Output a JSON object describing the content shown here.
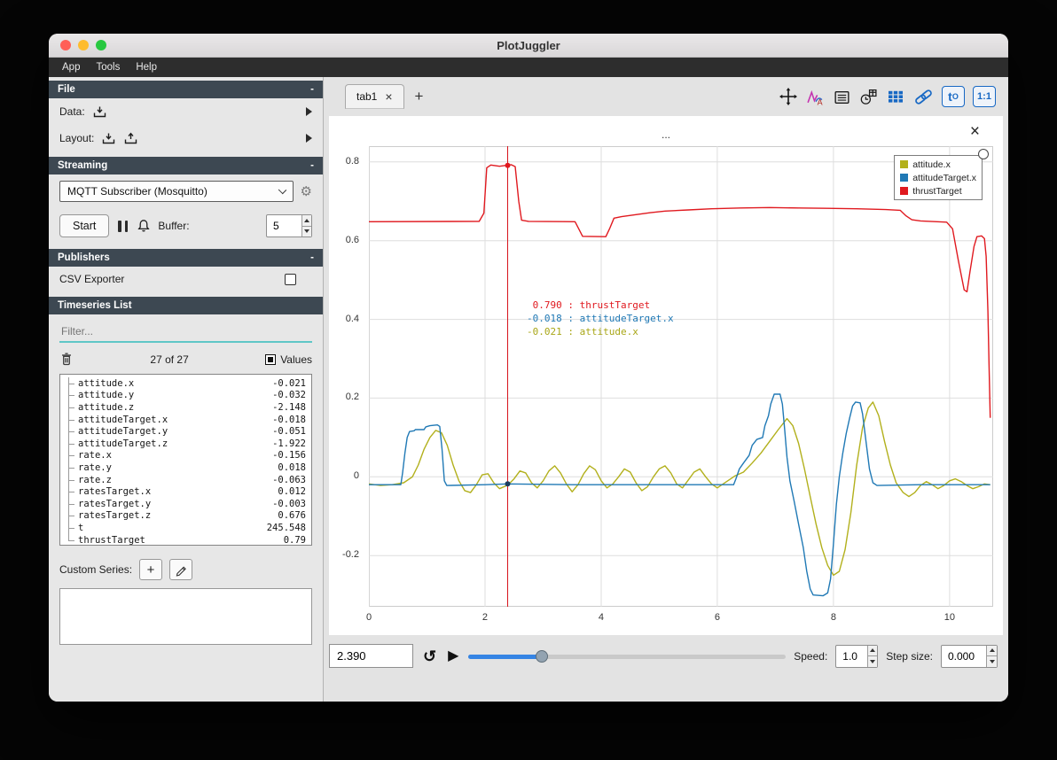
{
  "window": {
    "title": "PlotJuggler"
  },
  "menu": {
    "items": [
      "App",
      "Tools",
      "Help"
    ]
  },
  "sidebar": {
    "file": {
      "title": "File",
      "collapse": "-",
      "data_label": "Data:",
      "layout_label": "Layout:"
    },
    "streaming": {
      "title": "Streaming",
      "collapse": "-",
      "source": "MQTT Subscriber (Mosquitto)",
      "start_label": "Start",
      "buffer_label": "Buffer:",
      "buffer_value": "5"
    },
    "publishers": {
      "title": "Publishers",
      "collapse": "-",
      "csv_label": "CSV Exporter"
    },
    "timeseries": {
      "title": "Timeseries List",
      "collapse": "-",
      "filter_placeholder": "Filter...",
      "count": "27 of 27",
      "values_label": "Values",
      "items": [
        {
          "name": "attitude.x",
          "value": "-0.021"
        },
        {
          "name": "attitude.y",
          "value": "-0.032"
        },
        {
          "name": "attitude.z",
          "value": "-2.148"
        },
        {
          "name": "attitudeTarget.x",
          "value": "-0.018"
        },
        {
          "name": "attitudeTarget.y",
          "value": "-0.051"
        },
        {
          "name": "attitudeTarget.z",
          "value": "-1.922"
        },
        {
          "name": "rate.x",
          "value": "-0.156"
        },
        {
          "name": "rate.y",
          "value": "0.018"
        },
        {
          "name": "rate.z",
          "value": "-0.063"
        },
        {
          "name": "ratesTarget.x",
          "value": "0.012"
        },
        {
          "name": "ratesTarget.y",
          "value": "-0.003"
        },
        {
          "name": "ratesTarget.z",
          "value": "0.676"
        },
        {
          "name": "t",
          "value": "245.548"
        },
        {
          "name": "thrustTarget",
          "value": "0.79"
        }
      ]
    },
    "custom_series": {
      "label": "Custom Series:",
      "add_label": "+"
    }
  },
  "tabs": {
    "active": "tab1",
    "close": "×",
    "add": "+"
  },
  "toolbar": {
    "t_label": "t",
    "t_sub": "O",
    "ratio_label": "1:1"
  },
  "plot": {
    "title": "...",
    "close": "×",
    "legend": [
      {
        "label": "attitude.x",
        "color": "#b2b01c"
      },
      {
        "label": "attitudeTarget.x",
        "color": "#2079b5"
      },
      {
        "label": "thrustTarget",
        "color": "#e0191f"
      }
    ],
    "tracker_lines": [
      {
        "text": " 0.790 : thrustTarget",
        "color": "#e0191f"
      },
      {
        "text": "-0.018 : attitudeTarget.x",
        "color": "#2079b5"
      },
      {
        "text": "-0.021 : attitude.x",
        "color": "#a8a616"
      }
    ]
  },
  "chart_data": {
    "type": "line",
    "title": "...",
    "xlim": [
      0,
      10.75
    ],
    "ylim": [
      -0.33,
      0.84
    ],
    "x_ticks": [
      0,
      2,
      4,
      6,
      8,
      10
    ],
    "y_ticks": [
      -0.2,
      0,
      0.2,
      0.4,
      0.6,
      0.8
    ],
    "grid": true,
    "legend_position": "top-right",
    "tracker_x": 2.39,
    "tracker_color": "#d8141c",
    "tracker_markers": [
      {
        "x": 2.39,
        "y": 0.791,
        "color": "#e0191f"
      },
      {
        "x": 2.39,
        "y": -0.018,
        "color": "#1b3d5f"
      }
    ],
    "series": [
      {
        "name": "attitude.x",
        "color": "#b2b01c",
        "points": [
          [
            0,
            -0.018
          ],
          [
            0.2,
            -0.022
          ],
          [
            0.4,
            -0.02
          ],
          [
            0.6,
            -0.015
          ],
          [
            0.75,
            0
          ],
          [
            0.85,
            0.03
          ],
          [
            0.95,
            0.07
          ],
          [
            1.05,
            0.1
          ],
          [
            1.15,
            0.118
          ],
          [
            1.25,
            0.112
          ],
          [
            1.35,
            0.08
          ],
          [
            1.45,
            0.03
          ],
          [
            1.55,
            -0.01
          ],
          [
            1.65,
            -0.035
          ],
          [
            1.75,
            -0.04
          ],
          [
            1.85,
            -0.02
          ],
          [
            1.95,
            0.005
          ],
          [
            2.05,
            0.008
          ],
          [
            2.15,
            -0.015
          ],
          [
            2.25,
            -0.03
          ],
          [
            2.39,
            -0.021
          ],
          [
            2.5,
            -0.005
          ],
          [
            2.6,
            0.015
          ],
          [
            2.7,
            0.01
          ],
          [
            2.8,
            -0.015
          ],
          [
            2.9,
            -0.028
          ],
          [
            3,
            -0.01
          ],
          [
            3.1,
            0.015
          ],
          [
            3.2,
            0.028
          ],
          [
            3.3,
            0.01
          ],
          [
            3.4,
            -0.018
          ],
          [
            3.5,
            -0.038
          ],
          [
            3.6,
            -0.02
          ],
          [
            3.7,
            0.008
          ],
          [
            3.8,
            0.028
          ],
          [
            3.9,
            0.018
          ],
          [
            4,
            -0.01
          ],
          [
            4.1,
            -0.028
          ],
          [
            4.2,
            -0.018
          ],
          [
            4.3,
            0
          ],
          [
            4.4,
            0.02
          ],
          [
            4.5,
            0.012
          ],
          [
            4.6,
            -0.015
          ],
          [
            4.7,
            -0.035
          ],
          [
            4.8,
            -0.025
          ],
          [
            4.9,
            0
          ],
          [
            5,
            0.02
          ],
          [
            5.1,
            0.028
          ],
          [
            5.2,
            0.01
          ],
          [
            5.3,
            -0.018
          ],
          [
            5.4,
            -0.028
          ],
          [
            5.5,
            -0.008
          ],
          [
            5.6,
            0.012
          ],
          [
            5.7,
            0.02
          ],
          [
            5.8,
            0
          ],
          [
            5.9,
            -0.018
          ],
          [
            6,
            -0.028
          ],
          [
            6.1,
            -0.018
          ],
          [
            6.2,
            -0.008
          ],
          [
            6.3,
            0.002
          ],
          [
            6.45,
            0.012
          ],
          [
            6.6,
            0.035
          ],
          [
            6.75,
            0.06
          ],
          [
            6.9,
            0.09
          ],
          [
            7.05,
            0.12
          ],
          [
            7.2,
            0.148
          ],
          [
            7.3,
            0.13
          ],
          [
            7.4,
            0.085
          ],
          [
            7.5,
            0.02
          ],
          [
            7.6,
            -0.05
          ],
          [
            7.7,
            -0.12
          ],
          [
            7.8,
            -0.18
          ],
          [
            7.9,
            -0.225
          ],
          [
            8,
            -0.25
          ],
          [
            8.1,
            -0.24
          ],
          [
            8.2,
            -0.185
          ],
          [
            8.3,
            -0.09
          ],
          [
            8.4,
            0.03
          ],
          [
            8.5,
            0.125
          ],
          [
            8.6,
            0.175
          ],
          [
            8.68,
            0.19
          ],
          [
            8.78,
            0.155
          ],
          [
            8.88,
            0.09
          ],
          [
            8.98,
            0.03
          ],
          [
            9.08,
            -0.015
          ],
          [
            9.2,
            -0.04
          ],
          [
            9.3,
            -0.05
          ],
          [
            9.4,
            -0.04
          ],
          [
            9.5,
            -0.022
          ],
          [
            9.6,
            -0.012
          ],
          [
            9.7,
            -0.02
          ],
          [
            9.8,
            -0.03
          ],
          [
            9.9,
            -0.022
          ],
          [
            10,
            -0.01
          ],
          [
            10.1,
            -0.005
          ],
          [
            10.2,
            -0.012
          ],
          [
            10.3,
            -0.022
          ],
          [
            10.4,
            -0.03
          ],
          [
            10.5,
            -0.025
          ],
          [
            10.6,
            -0.018
          ],
          [
            10.7,
            -0.02
          ]
        ]
      },
      {
        "name": "attitudeTarget.x",
        "color": "#2079b5",
        "points": [
          [
            0,
            -0.02
          ],
          [
            0.55,
            -0.02
          ],
          [
            0.58,
            0.01
          ],
          [
            0.62,
            0.06
          ],
          [
            0.66,
            0.1
          ],
          [
            0.7,
            0.115
          ],
          [
            0.78,
            0.117
          ],
          [
            0.8,
            0.12
          ],
          [
            0.95,
            0.12
          ],
          [
            0.98,
            0.127
          ],
          [
            1.05,
            0.13
          ],
          [
            1.18,
            0.132
          ],
          [
            1.22,
            0.128
          ],
          [
            1.26,
            0.07
          ],
          [
            1.3,
            -0.01
          ],
          [
            1.34,
            -0.022
          ],
          [
            2,
            -0.02
          ],
          [
            2.39,
            -0.018
          ],
          [
            3.5,
            -0.02
          ],
          [
            5,
            -0.02
          ],
          [
            6.28,
            -0.02
          ],
          [
            6.32,
            -0.005
          ],
          [
            6.38,
            0.02
          ],
          [
            6.45,
            0.035
          ],
          [
            6.55,
            0.055
          ],
          [
            6.6,
            0.08
          ],
          [
            6.68,
            0.095
          ],
          [
            6.78,
            0.1
          ],
          [
            6.82,
            0.13
          ],
          [
            6.88,
            0.155
          ],
          [
            6.92,
            0.185
          ],
          [
            6.98,
            0.21
          ],
          [
            7.08,
            0.21
          ],
          [
            7.12,
            0.185
          ],
          [
            7.16,
            0.12
          ],
          [
            7.2,
            0.05
          ],
          [
            7.25,
            -0.01
          ],
          [
            7.32,
            -0.06
          ],
          [
            7.4,
            -0.12
          ],
          [
            7.48,
            -0.18
          ],
          [
            7.54,
            -0.24
          ],
          [
            7.6,
            -0.285
          ],
          [
            7.65,
            -0.3
          ],
          [
            7.82,
            -0.302
          ],
          [
            7.9,
            -0.295
          ],
          [
            7.95,
            -0.26
          ],
          [
            8,
            -0.17
          ],
          [
            8.05,
            -0.07
          ],
          [
            8.1,
            0
          ],
          [
            8.16,
            0.06
          ],
          [
            8.22,
            0.11
          ],
          [
            8.28,
            0.15
          ],
          [
            8.33,
            0.18
          ],
          [
            8.38,
            0.19
          ],
          [
            8.46,
            0.188
          ],
          [
            8.5,
            0.16
          ],
          [
            8.56,
            0.09
          ],
          [
            8.62,
            0.02
          ],
          [
            8.68,
            -0.015
          ],
          [
            8.75,
            -0.022
          ],
          [
            9.5,
            -0.02
          ],
          [
            10.7,
            -0.02
          ]
        ]
      },
      {
        "name": "thrustTarget",
        "color": "#e0191f",
        "points": [
          [
            0,
            0.648
          ],
          [
            1.9,
            0.649
          ],
          [
            1.98,
            0.67
          ],
          [
            2.03,
            0.785
          ],
          [
            2.1,
            0.792
          ],
          [
            2.25,
            0.789
          ],
          [
            2.45,
            0.793
          ],
          [
            2.52,
            0.788
          ],
          [
            2.58,
            0.7
          ],
          [
            2.63,
            0.652
          ],
          [
            2.75,
            0.649
          ],
          [
            3.55,
            0.648
          ],
          [
            3.62,
            0.628
          ],
          [
            3.68,
            0.611
          ],
          [
            4.08,
            0.61
          ],
          [
            4.15,
            0.632
          ],
          [
            4.22,
            0.657
          ],
          [
            4.35,
            0.661
          ],
          [
            4.6,
            0.666
          ],
          [
            4.85,
            0.671
          ],
          [
            5.1,
            0.675
          ],
          [
            5.5,
            0.678
          ],
          [
            5.9,
            0.681
          ],
          [
            6.4,
            0.683
          ],
          [
            6.9,
            0.684
          ],
          [
            7.4,
            0.683
          ],
          [
            7.9,
            0.682
          ],
          [
            8.4,
            0.681
          ],
          [
            8.9,
            0.679
          ],
          [
            9.15,
            0.677
          ],
          [
            9.25,
            0.663
          ],
          [
            9.35,
            0.653
          ],
          [
            9.5,
            0.65
          ],
          [
            9.95,
            0.647
          ],
          [
            10.05,
            0.63
          ],
          [
            10.15,
            0.55
          ],
          [
            10.25,
            0.475
          ],
          [
            10.3,
            0.47
          ],
          [
            10.35,
            0.52
          ],
          [
            10.42,
            0.585
          ],
          [
            10.47,
            0.61
          ],
          [
            10.55,
            0.612
          ],
          [
            10.6,
            0.605
          ],
          [
            10.63,
            0.56
          ],
          [
            10.66,
            0.42
          ],
          [
            10.68,
            0.28
          ],
          [
            10.7,
            0.15
          ]
        ]
      }
    ]
  },
  "playback": {
    "time": "2.390",
    "progress_pct": 23,
    "loop_glyph": "↺",
    "play_glyph": "▶",
    "speed_label": "Speed:",
    "speed_value": "1.0",
    "step_label": "Step size:",
    "step_value": "0.000"
  }
}
